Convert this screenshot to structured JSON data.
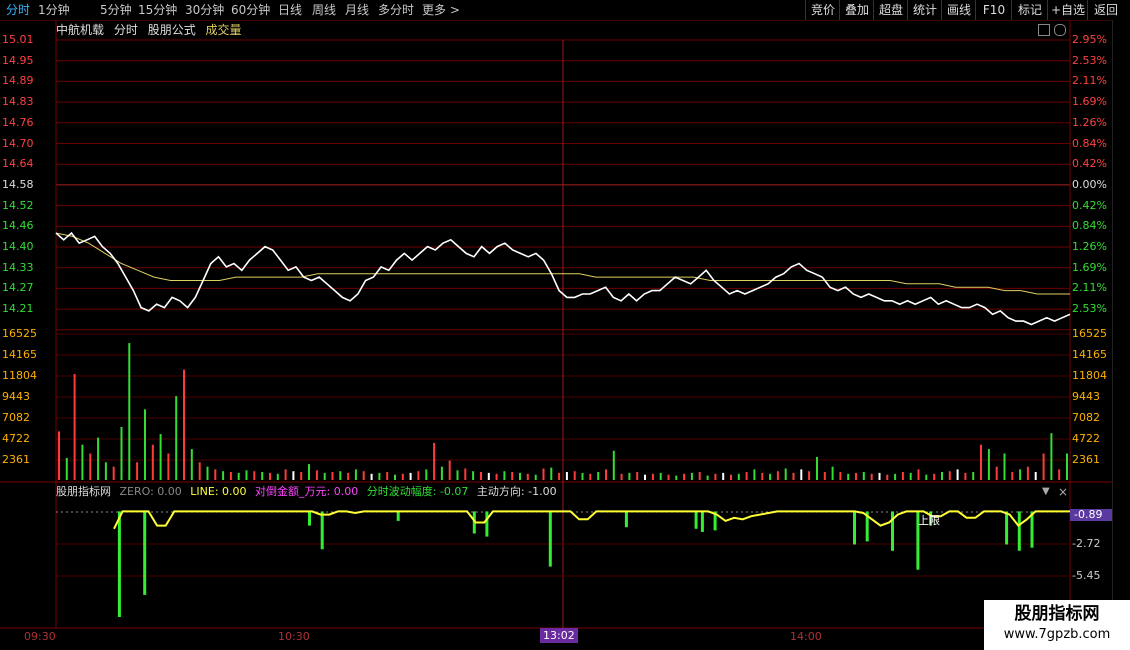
{
  "toolbar": {
    "left_items": [
      "分时",
      "1分钟",
      "5分钟",
      "15分钟",
      "30分钟",
      "60分钟",
      "日线",
      "周线",
      "月线",
      "多分时",
      "更多 >"
    ],
    "right_items": [
      "竞价",
      "叠加",
      "超盘",
      "统计",
      "画线",
      "F10",
      "标记",
      "+自选",
      "返回"
    ]
  },
  "header": {
    "stock_name": "中航机载",
    "chart_mode": "分时",
    "formula": "股朋公式",
    "volume_label": "成交量"
  },
  "price_axis": {
    "left": [
      "15.01",
      "14.95",
      "14.89",
      "14.83",
      "14.76",
      "14.70",
      "14.64",
      "14.58",
      "14.52",
      "14.46",
      "14.40",
      "14.33",
      "14.27",
      "14.21"
    ],
    "right": [
      "2.95%",
      "2.53%",
      "2.11%",
      "1.69%",
      "1.26%",
      "0.84%",
      "0.42%",
      "0.00%",
      "0.42%",
      "0.84%",
      "1.26%",
      "1.69%",
      "2.11%",
      "2.53%"
    ],
    "ref_price": 14.58,
    "min": 14.18,
    "max": 15.01
  },
  "volume_axis": {
    "labels": [
      "16525",
      "14165",
      "11804",
      "9443",
      "7082",
      "4722",
      "2361"
    ],
    "max": 16525
  },
  "indicator": {
    "name": "股朋指标网",
    "zero_label": "ZERO: 0.00",
    "line_label": "LINE: 0.00",
    "amount_label": "对倒金额_万元: 0.00",
    "volatility_label": "分时波动幅度: -0.07",
    "direction_label": "主动方向: -1.00",
    "axis": [
      "-0.89",
      "-2.72",
      "-5.45"
    ],
    "upper_limit_label": "上限",
    "min": -7.5,
    "max": 0.5
  },
  "time_axis": {
    "labels": [
      "09:30",
      "10:30",
      "13:02",
      "14:00"
    ]
  },
  "watermark": {
    "line1": "股朋指标网",
    "line2": "www.7gpzb.com"
  },
  "colors": {
    "up": "#ff3b3b",
    "down": "#33dd33",
    "price": "#ffffff",
    "avg": "#e0d060",
    "grid": "#7a0000",
    "indicator": "#ffff33"
  },
  "chart_data": {
    "type": "line",
    "price_series": [
      14.44,
      14.42,
      14.44,
      14.41,
      14.42,
      14.43,
      14.4,
      14.38,
      14.35,
      14.31,
      14.27,
      14.22,
      14.21,
      14.23,
      14.22,
      14.25,
      14.24,
      14.22,
      14.25,
      14.3,
      14.35,
      14.37,
      14.34,
      14.35,
      14.33,
      14.36,
      14.38,
      14.4,
      14.39,
      14.36,
      14.33,
      14.34,
      14.31,
      14.3,
      14.31,
      14.29,
      14.27,
      14.25,
      14.24,
      14.26,
      14.3,
      14.31,
      14.34,
      14.33,
      14.36,
      14.38,
      14.36,
      14.38,
      14.4,
      14.39,
      14.41,
      14.42,
      14.4,
      14.38,
      14.37,
      14.4,
      14.38,
      14.4,
      14.41,
      14.39,
      14.38,
      14.37,
      14.38,
      14.36,
      14.32,
      14.27,
      14.25,
      14.25,
      14.26,
      14.26,
      14.27,
      14.28,
      14.25,
      14.24,
      14.26,
      14.24,
      14.26,
      14.27,
      14.27,
      14.29,
      14.31,
      14.3,
      14.29,
      14.31,
      14.33,
      14.3,
      14.28,
      14.26,
      14.27,
      14.26,
      14.27,
      14.28,
      14.29,
      14.31,
      14.32,
      14.34,
      14.35,
      14.33,
      14.32,
      14.31,
      14.28,
      14.27,
      14.28,
      14.26,
      14.25,
      14.26,
      14.25,
      14.24,
      14.24,
      14.23,
      14.24,
      14.23,
      14.24,
      14.25,
      14.23,
      14.24,
      14.23,
      14.22,
      14.22,
      14.23,
      14.22,
      14.2,
      14.21,
      14.19,
      14.18,
      14.18,
      14.17,
      14.18,
      14.19,
      14.18,
      14.19,
      14.2
    ],
    "avg_series": [
      14.44,
      14.43,
      14.41,
      14.38,
      14.35,
      14.33,
      14.31,
      14.3,
      14.3,
      14.3,
      14.3,
      14.31,
      14.31,
      14.31,
      14.31,
      14.31,
      14.32,
      14.32,
      14.32,
      14.32,
      14.32,
      14.32,
      14.32,
      14.32,
      14.32,
      14.32,
      14.32,
      14.32,
      14.32,
      14.32,
      14.32,
      14.32,
      14.32,
      14.31,
      14.31,
      14.31,
      14.31,
      14.31,
      14.31,
      14.31,
      14.3,
      14.3,
      14.3,
      14.3,
      14.3,
      14.3,
      14.3,
      14.3,
      14.3,
      14.3,
      14.3,
      14.3,
      14.29,
      14.29,
      14.29,
      14.28,
      14.28,
      14.28,
      14.27,
      14.27,
      14.26,
      14.26,
      14.26
    ],
    "volumes": [
      5500,
      2500,
      12000,
      4000,
      3000,
      4800,
      2000,
      1500,
      6000,
      15500,
      2000,
      8000,
      4000,
      5200,
      3000,
      9500,
      12500,
      3500,
      2000,
      1500,
      1200,
      1000,
      900,
      800,
      1100,
      1000,
      900,
      800,
      700,
      1200,
      1000,
      900,
      1800,
      1100,
      800,
      900,
      1000,
      800,
      1200,
      1000,
      700,
      800,
      900,
      600,
      700,
      800,
      1000,
      1200,
      4200,
      1500,
      2200,
      1100,
      1300,
      1000,
      900,
      800,
      700,
      1000,
      900,
      800,
      700,
      600,
      1300,
      1400,
      800,
      900,
      1000,
      800,
      700,
      900,
      1200,
      3300,
      700,
      800,
      900,
      600,
      700,
      800,
      600,
      500,
      700,
      800,
      900,
      500,
      700,
      800,
      600,
      700,
      900,
      1200,
      800,
      700,
      1000,
      1300,
      800,
      1200,
      1000,
      2600,
      900,
      1500,
      900,
      700,
      800,
      900,
      700,
      800,
      600,
      700,
      900,
      800,
      1200,
      600,
      700,
      900,
      1000,
      1200,
      800,
      900,
      4000,
      3500,
      1500,
      3000,
      900,
      1200,
      1500,
      900,
      3000,
      5300,
      1200,
      3000
    ],
    "volume_up": [
      true,
      false,
      true,
      false,
      true,
      false,
      false,
      true,
      false,
      false,
      true,
      false,
      true,
      false,
      true,
      false,
      true,
      false,
      true,
      false,
      true,
      false,
      true,
      false,
      false,
      true,
      false,
      true,
      false,
      true,
      false,
      true,
      false,
      true,
      false,
      true,
      false,
      true,
      false,
      true,
      false,
      false,
      true,
      false,
      true,
      false,
      true,
      false,
      true,
      false,
      true,
      false,
      true,
      false,
      true,
      false,
      true,
      false,
      true,
      false,
      true,
      false,
      true,
      false,
      true,
      false,
      true,
      false,
      true,
      false,
      true,
      false,
      true,
      false,
      true,
      false,
      true,
      false,
      true,
      false,
      true,
      false,
      true,
      false,
      true,
      false,
      true,
      false,
      true,
      false,
      true,
      false,
      true,
      false,
      true,
      false,
      true,
      false,
      true,
      false,
      true,
      false,
      true,
      false,
      true,
      false,
      true,
      false,
      true,
      false,
      true,
      false,
      true,
      false,
      true,
      false,
      true,
      false,
      true,
      false,
      true,
      false,
      true,
      false,
      true,
      false,
      true,
      false,
      true,
      false,
      true,
      false
    ],
    "indicator_line": [
      -1.2,
      -0.1,
      -0.1,
      -0.1,
      -0.1,
      -1.0,
      -1.0,
      -0.1,
      -0.1,
      -0.1,
      -0.1,
      -0.1,
      -0.1,
      -0.1,
      -0.1,
      -0.1,
      -0.1,
      -0.1,
      -0.1,
      -0.1,
      -0.1,
      -0.1,
      -0.1,
      -0.1,
      -0.3,
      -0.3,
      -0.1,
      -0.1,
      -0.2,
      -0.1,
      -0.1,
      -0.1,
      -0.1,
      -0.1,
      -0.1,
      -0.1,
      -0.1,
      -0.1,
      -0.1,
      -0.1,
      -0.1,
      -0.1,
      -0.8,
      -0.8,
      -0.1,
      -0.1,
      -0.1,
      -0.1,
      -0.1,
      -0.1,
      -0.1,
      -0.1,
      -0.1,
      -0.1,
      -0.6,
      -0.6,
      -0.1,
      -0.1,
      -0.1,
      -0.1,
      -0.1,
      -0.1,
      -0.1,
      -0.1,
      -0.1,
      -0.1,
      -0.1,
      -0.1,
      -0.1,
      -0.1,
      -0.3,
      -0.7,
      -0.5,
      -0.6,
      -0.4,
      -0.3,
      -0.2,
      -0.1,
      -0.1,
      -0.1,
      -0.1,
      -0.1,
      -0.1,
      -0.1,
      -0.1,
      -0.1,
      -0.1,
      -0.2,
      -0.6,
      -1.0,
      -0.8,
      -0.3,
      -0.1,
      -0.1,
      -0.1,
      -0.4,
      -0.4,
      -0.1,
      -0.1,
      -0.5,
      -0.5,
      -0.1,
      -0.1,
      -0.1,
      -0.3,
      -1.0,
      -0.6,
      -0.1,
      -0.1,
      -0.1,
      -0.1,
      -0.1
    ],
    "indicator_bars": [
      [
        10,
        -6.8
      ],
      [
        14,
        -5.4
      ],
      [
        40,
        -1.0
      ],
      [
        42,
        -2.5
      ],
      [
        54,
        -0.7
      ],
      [
        66,
        -1.5
      ],
      [
        68,
        -1.7
      ],
      [
        78,
        -3.6
      ],
      [
        90,
        -1.1
      ],
      [
        101,
        -1.2
      ],
      [
        102,
        -1.4
      ],
      [
        104,
        -1.3
      ],
      [
        126,
        -2.2
      ],
      [
        128,
        -2.0
      ],
      [
        132,
        -2.6
      ],
      [
        136,
        -3.8
      ],
      [
        138,
        -1.0
      ],
      [
        150,
        -2.2
      ],
      [
        152,
        -2.6
      ],
      [
        154,
        -2.4
      ]
    ]
  }
}
